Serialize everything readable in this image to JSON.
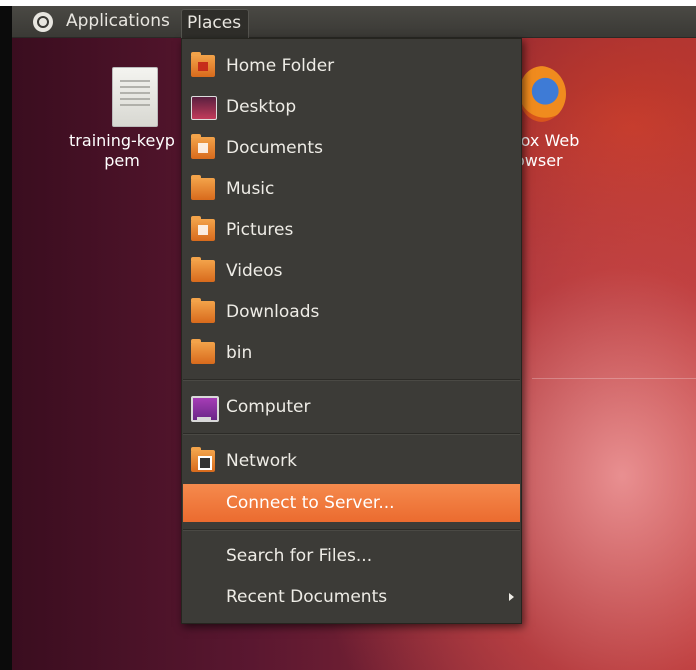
{
  "panel": {
    "applications_label": "Applications",
    "places_label": "Places"
  },
  "desktop": {
    "icons": [
      {
        "label_line1": "training-keyp",
        "label_line2": "pem",
        "icon": "text-file-icon"
      },
      {
        "label_line1": "fox Web",
        "label_line2": "owser",
        "icon": "firefox-icon"
      }
    ]
  },
  "menu": {
    "items": [
      {
        "label": "Home Folder",
        "icon": "home-folder-icon"
      },
      {
        "label": "Desktop",
        "icon": "desktop-icon"
      },
      {
        "label": "Documents",
        "icon": "documents-folder-icon"
      },
      {
        "label": "Music",
        "icon": "music-folder-icon"
      },
      {
        "label": "Pictures",
        "icon": "pictures-folder-icon"
      },
      {
        "label": "Videos",
        "icon": "videos-folder-icon"
      },
      {
        "label": "Downloads",
        "icon": "downloads-folder-icon"
      },
      {
        "label": "bin",
        "icon": "folder-icon"
      },
      {
        "label": "Computer",
        "icon": "computer-icon"
      },
      {
        "label": "Network",
        "icon": "network-icon"
      },
      {
        "label": "Connect to Server...",
        "icon": ""
      },
      {
        "label": "Search for Files...",
        "icon": ""
      },
      {
        "label": "Recent Documents",
        "icon": "",
        "submenu": true
      }
    ],
    "highlight_color": "#f07a3a"
  }
}
